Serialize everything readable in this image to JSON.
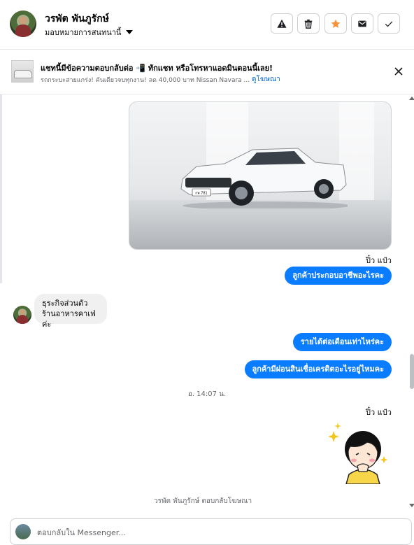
{
  "header": {
    "contact_name": "วรพัต พันภูรักษ์",
    "assign_label": "มอบหมายการสนทนานี้",
    "toolbar": [
      {
        "icon": "warning-icon",
        "label": "spam"
      },
      {
        "icon": "trash-icon",
        "label": "delete"
      },
      {
        "icon": "star-icon",
        "label": "follow-up"
      },
      {
        "icon": "mail-icon",
        "label": "mark-unread"
      },
      {
        "icon": "check-icon",
        "label": "done"
      }
    ],
    "star_color": "#f7923a"
  },
  "banner": {
    "title": "แชทนี้มีข้อความตอบกลับต่อ 📲 ทักแชท หรือโทรหาแอดมินตอนนี้เลย!",
    "subtitle": "รถกระบะสายแกร่ง! คันเดียวจบทุกงาน! ลด 40,000 บาท Nissan Navara ...",
    "link": "ดูโฆษณา"
  },
  "conversation": {
    "sender_outgoing": "ปิ๋ว แป๋ว",
    "messages_out_1": [
      "ลูกค้าประกอบอาชีพอะไรคะ"
    ],
    "message_in": [
      "ธุระกิจส่วนตัว",
      "ร้านอาหารคาเฟ่ค่ะ"
    ],
    "messages_out_2": [
      "รายได้ต่อเดือนเท่าไหร่คะ",
      "ลูกค้ามีผ่อนสินเชื่อเครดิตอะไรอยู่ไหมคะ"
    ],
    "timestamp": "อ. 14:07 น.",
    "sender_outgoing_2": "ปิ๋ว แป๋ว",
    "replied_note": "วรพัต พันภูรักษ์ ตอบกลับโฆษณา",
    "plate_text": "กพ 781"
  },
  "composer": {
    "placeholder": "ตอบกลับใน Messenger..."
  },
  "colors": {
    "accent": "#0a7cff",
    "link": "#0064d1",
    "muted": "#65676b"
  }
}
